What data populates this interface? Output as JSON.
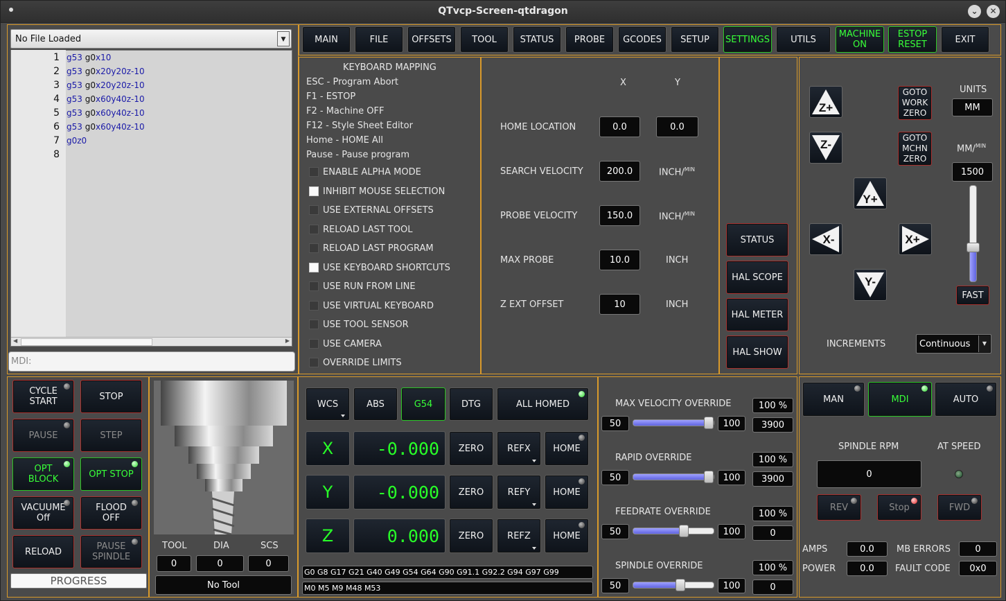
{
  "window": {
    "title": "QTvcp-Screen-qtdragon"
  },
  "file": {
    "combo": "No File Loaded",
    "mdi_placeholder": "MDI:"
  },
  "gcode": {
    "line_numbers": [
      "1",
      "2",
      "3",
      "4",
      "5",
      "6",
      "7",
      "8"
    ],
    "lines": [
      [
        [
          "g53 ",
          "k"
        ],
        [
          "g0",
          ""
        ],
        [
          "x10",
          "k"
        ]
      ],
      [
        [
          "g53 ",
          "k"
        ],
        [
          "g0",
          ""
        ],
        [
          "x20y20z-10",
          "k"
        ]
      ],
      [
        [
          "g53 ",
          "k"
        ],
        [
          "g0",
          ""
        ],
        [
          "x20y20z-10",
          "k"
        ]
      ],
      [
        [
          "g53 ",
          "k"
        ],
        [
          "g0",
          ""
        ],
        [
          "x60y40z-10",
          "k"
        ]
      ],
      [
        [
          "g53 ",
          "k"
        ],
        [
          "g0",
          ""
        ],
        [
          "x60y40z-10",
          "k"
        ]
      ],
      [
        [
          "g53 ",
          "k"
        ],
        [
          "g0",
          ""
        ],
        [
          "x60y40z-10",
          "k"
        ]
      ],
      [
        [
          "g0z0",
          "k"
        ]
      ]
    ]
  },
  "tabs": [
    "MAIN",
    "FILE",
    "OFFSETS",
    "TOOL",
    "STATUS",
    "PROBE",
    "GCODES",
    "SETUP",
    "SETTINGS",
    "UTILS",
    "MACHINE ON",
    "ESTOP RESET",
    "EXIT"
  ],
  "keyboard": {
    "title": "KEYBOARD MAPPING",
    "items": [
      "ESC - Program Abort",
      "F1 - ESTOP",
      "F2 - Machine OFF",
      "F12 - Style Sheet Editor",
      "Home - HOME All",
      "Pause - Pause program"
    ]
  },
  "options": [
    {
      "label": "ENABLE ALPHA MODE",
      "checked": false
    },
    {
      "label": "INHIBIT MOUSE SELECTION",
      "checked": true
    },
    {
      "label": "USE EXTERNAL OFFSETS",
      "checked": false
    },
    {
      "label": "RELOAD LAST TOOL",
      "checked": false
    },
    {
      "label": "RELOAD LAST PROGRAM",
      "checked": false
    },
    {
      "label": "USE KEYBOARD SHORTCUTS",
      "checked": true
    },
    {
      "label": "USE RUN FROM LINE",
      "checked": false
    },
    {
      "label": "USE VIRTUAL KEYBOARD",
      "checked": false
    },
    {
      "label": "USE TOOL SENSOR",
      "checked": false
    },
    {
      "label": "USE CAMERA",
      "checked": false
    },
    {
      "label": "OVERRIDE LIMITS",
      "checked": false
    }
  ],
  "probe": {
    "col_x": "X",
    "col_y": "Y",
    "home_label": "HOME LOCATION",
    "home_x": "0.0",
    "home_y": "0.0",
    "search_label": "SEARCH VELOCITY",
    "search_val": "200.0",
    "search_unit": "INCH/",
    "unit_min": "MIN",
    "probe_label": "PROBE VELOCITY",
    "probe_val": "150.0",
    "probe_unit": "INCH/",
    "max_label": "MAX PROBE",
    "max_val": "10.0",
    "max_unit": "INCH",
    "zext_label": "Z EXT OFFSET",
    "zext_val": "10",
    "zext_unit": "INCH"
  },
  "side_buttons": [
    "STATUS",
    "HAL SCOPE",
    "HAL METER",
    "HAL SHOW"
  ],
  "jog": {
    "z_plus": "Z+",
    "z_minus": "Z-",
    "y_plus": "Y+",
    "y_minus": "Y-",
    "x_minus": "X-",
    "x_plus": "X+",
    "goto_work": "GOTO WORK ZERO",
    "goto_mchn": "GOTO MCHN ZERO",
    "units_label": "UNITS",
    "units": "MM",
    "rate_label": "MM/",
    "rate_min": "MIN",
    "rate": "1500",
    "fast": "FAST",
    "increments_label": "INCREMENTS",
    "increments": "Continuous",
    "rate_fraction": 0.35
  },
  "controls": {
    "cycle_start": "CYCLE START",
    "stop": "STOP",
    "pause": "PAUSE",
    "step": "STEP",
    "opt_block": "OPT BLOCK",
    "opt_stop": "OPT STOP",
    "vacuum": "VACUUME Off",
    "flood": "FLOOD OFF",
    "reload": "RELOAD",
    "pause_spindle": "PAUSE SPINDLE",
    "progress": "PROGRESS"
  },
  "tool": {
    "tool_label": "TOOL",
    "dia_label": "DIA",
    "scs_label": "SCS",
    "tool": "0",
    "dia": "0",
    "scs": "0",
    "name": "No Tool"
  },
  "dro": {
    "wcs": "WCS",
    "abs": "ABS",
    "g54": "G54",
    "dtg": "DTG",
    "all_homed": "ALL HOMED",
    "axes": [
      {
        "axis": "X",
        "value": "-0.000",
        "ref": "REFX"
      },
      {
        "axis": "Y",
        "value": "-0.000",
        "ref": "REFY"
      },
      {
        "axis": "Z",
        "value": "0.000",
        "ref": "REFZ"
      }
    ],
    "zero": "ZERO",
    "home": "HOME",
    "gcodes": "G0 G8 G17 G21 G40 G49 G54 G64 G90 G91.1 G92.2 G94 G97 G99",
    "mcodes": "M0 M5 M9 M48 M53"
  },
  "overrides": [
    {
      "label": "MAX VELOCITY OVERRIDE",
      "min": "50",
      "max": "100",
      "pct": "100 %",
      "value": "3900",
      "fraction": 1.0
    },
    {
      "label": "RAPID OVERRIDE",
      "min": "50",
      "max": "100",
      "pct": "100 %",
      "value": "3900",
      "fraction": 1.0
    },
    {
      "label": "FEEDRATE OVERRIDE",
      "min": "50",
      "max": "100",
      "pct": "100 %",
      "value": "0",
      "fraction": 0.65
    },
    {
      "label": "SPINDLE OVERRIDE",
      "min": "50",
      "max": "100",
      "pct": "100 %",
      "value": "0",
      "fraction": 0.6
    }
  ],
  "spindle": {
    "man": "MAN",
    "mdi": "MDI",
    "auto": "AUTO",
    "rpm_label": "SPINDLE RPM",
    "at_speed": "AT SPEED",
    "rpm": "0",
    "rev": "REV",
    "stop": "Stop",
    "fwd": "FWD",
    "amps_label": "AMPS",
    "amps": "0.0",
    "power_label": "POWER",
    "power": "0.0",
    "mb_label": "MB ERRORS",
    "mb": "0",
    "fault_label": "FAULT CODE",
    "fault": "0x0"
  },
  "colors": {
    "accent_border": "#d99a2b",
    "led_green": "#2ad42a",
    "text_green": "#28ff28"
  }
}
